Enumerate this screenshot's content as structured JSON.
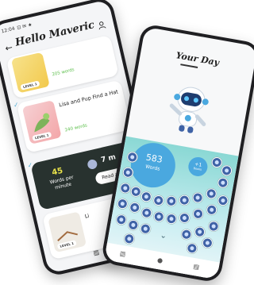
{
  "back_phone": {
    "status_time": "12:04",
    "status_icons": "⊡ ✉ ★",
    "greeting": "Hello Maveric",
    "cards": [
      {
        "title": "",
        "words": "205 words",
        "level": "LEVEL 1"
      },
      {
        "title": "Lisa and Pup Find a Hat",
        "words": "240 words",
        "level": "LEVEL 1"
      },
      {
        "title": "Li",
        "words": "",
        "level": "LEVEL 1"
      }
    ],
    "wpm": {
      "value": "45",
      "label": "Words per minute",
      "count": "7",
      "count_suffix": "m",
      "button": "Read again"
    }
  },
  "front_phone": {
    "title": "Your Day",
    "words_count": "583",
    "words_label": "Words",
    "small_count": "+1",
    "small_label": "Books",
    "chevron": "⌄"
  },
  "colors": {
    "accent_blue": "#4aa8df",
    "teal": "#8ad8d4",
    "dark_card": "#28322f",
    "green": "#5bbf4a"
  },
  "icons": [
    "user-icon",
    "back-arrow-icon",
    "robot-mascot",
    "word-coin-icon",
    "book-icon",
    "home-icon",
    "chevron-down-icon"
  ]
}
